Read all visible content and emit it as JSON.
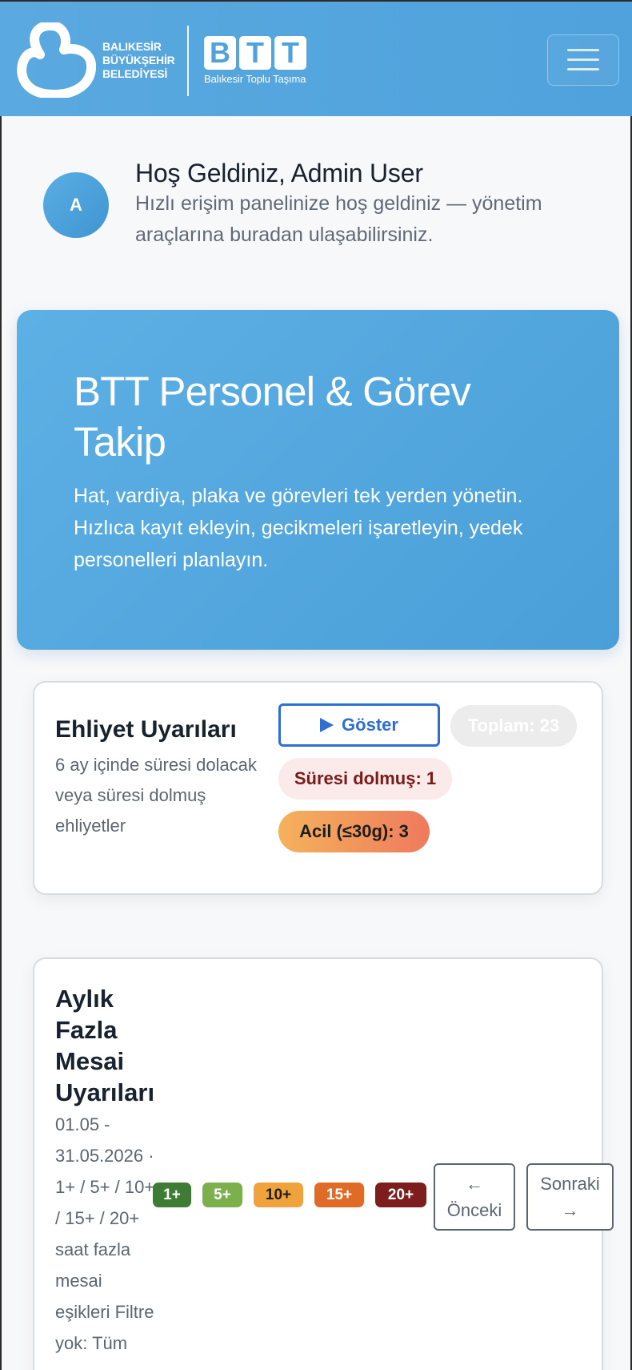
{
  "header": {
    "logo_lines": [
      "BALIKESİR",
      "BÜYÜKŞEHİR",
      "BELEDİYESİ"
    ],
    "btt_letters": [
      "B",
      "T",
      "T"
    ],
    "btt_subtitle": "Balıkesir Toplu Taşıma",
    "menu_icon": "hamburger-icon"
  },
  "welcome": {
    "avatar_initial": "A",
    "title": "Hoş Geldiniz, Admin User",
    "subtitle": "Hızlı erişim panelinize hoş geldiniz — yönetim araçlarına buradan ulaşabilirsiniz."
  },
  "hero": {
    "title": "BTT Personel & Görev Takip",
    "subtitle": "Hat, vardiya, plaka ve görevleri tek yerden yönetin. Hızlıca kayıt ekleyin, gecikmeleri işaretleyin, yedek personelleri planlayın."
  },
  "license_card": {
    "title": "Ehliyet Uyarıları",
    "description": "6 ay içinde süresi dolacak veya süresi dolmuş ehliyetler",
    "show_button": "Göster",
    "total": "Toplam: 23",
    "expired": "Süresi dolmuş: 1",
    "urgent": "Acil (≤30g): 3"
  },
  "overtime_card": {
    "title": "Aylık Fazla Mesai Uyarıları",
    "description": "01.05 - 31.05.2026 · 1+ / 5+ / 10+ / 15+ / 20+ saat fazla mesai eşikleri Filtre yok: Tüm",
    "badges": [
      "1+",
      "5+",
      "10+",
      "15+",
      "20+"
    ],
    "prev_arrow": "←",
    "prev_label": "Önceki",
    "next_label": "Sonraki",
    "next_arrow": "→"
  },
  "colors": {
    "header_bg": "#4fa2dc",
    "primary_button": "#2f6fd4",
    "badge_1": "#3e7b34",
    "badge_5": "#7bb04d",
    "badge_10": "#f0a33d",
    "badge_15": "#df6b26",
    "badge_20": "#7e1d1d"
  }
}
